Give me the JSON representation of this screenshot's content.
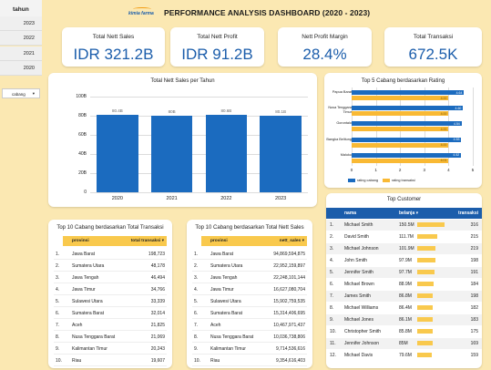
{
  "sidebar": {
    "header": "tahun",
    "years": [
      "2023",
      "2022",
      "2021",
      "2020"
    ],
    "filter_label": "cabang",
    "filter_chevron": "▾"
  },
  "header": {
    "logo_text": "kimia farma",
    "title": "PERFORMANCE ANALYSIS DASHBOARD (2020 - 2023)"
  },
  "kpis": [
    {
      "label": "Total Nett Sales",
      "value": "IDR 321.2B"
    },
    {
      "label": "Total Nett Profit",
      "value": "IDR 91.2B"
    },
    {
      "label": "Nett Profit Margin",
      "value": "28.4%"
    },
    {
      "label": "Total Transaksi",
      "value": "672.5K"
    }
  ],
  "sales_chart": {
    "title": "Total Nett Sales per Tahun",
    "y_ticks": [
      "100B",
      "80B",
      "60B",
      "40B",
      "20B",
      "0"
    ]
  },
  "rating_chart": {
    "title": "Top 5 Cabang berdasarkan Rating",
    "x_ticks": [
      "0",
      "1",
      "2",
      "3",
      "4",
      "5"
    ],
    "legend": {
      "rating_cabang": "rating cabang",
      "rating_transaksi": "rating transaksi"
    }
  },
  "table_trans": {
    "title": "Top 10 Cabang berdasarkan Total Transaksi",
    "col1": "provinsi",
    "col2": "total transaksi",
    "sort_icon": "▾",
    "rows": [
      {
        "no": "1.",
        "prov": "Jawa Barat",
        "val": "198,723"
      },
      {
        "no": "2.",
        "prov": "Sumatera Utara",
        "val": "48,178"
      },
      {
        "no": "3.",
        "prov": "Jawa Tengah",
        "val": "46,494"
      },
      {
        "no": "4.",
        "prov": "Jawa Timur",
        "val": "34,766"
      },
      {
        "no": "5.",
        "prov": "Sulawesi Utara",
        "val": "33,339"
      },
      {
        "no": "6.",
        "prov": "Sumatera Barat",
        "val": "32,014"
      },
      {
        "no": "7.",
        "prov": "Aceh",
        "val": "21,825"
      },
      {
        "no": "8.",
        "prov": "Nusa Tenggara Barat",
        "val": "21,069"
      },
      {
        "no": "9.",
        "prov": "Kalimantan Timur",
        "val": "20,243"
      },
      {
        "no": "10.",
        "prov": "Riau",
        "val": "19,607"
      }
    ]
  },
  "table_sales": {
    "title": "Top 10 Cabang berdasarkan Total Nett Sales",
    "col1": "provinsi",
    "col2": "nett_sales",
    "sort_icon": "▾",
    "rows": [
      {
        "no": "1.",
        "prov": "Jawa Barat",
        "val": "94,869,594,875"
      },
      {
        "no": "2.",
        "prov": "Sumatera Utara",
        "val": "22,952,159,897"
      },
      {
        "no": "3.",
        "prov": "Jawa Tengah",
        "val": "22,248,101,144"
      },
      {
        "no": "4.",
        "prov": "Jawa Timur",
        "val": "16,627,080,704"
      },
      {
        "no": "5.",
        "prov": "Sulawesi Utara",
        "val": "15,902,759,535"
      },
      {
        "no": "6.",
        "prov": "Sumatera Barat",
        "val": "15,314,406,695"
      },
      {
        "no": "7.",
        "prov": "Aceh",
        "val": "10,467,971,437"
      },
      {
        "no": "8.",
        "prov": "Nusa Tenggara Barat",
        "val": "10,036,738,806"
      },
      {
        "no": "9.",
        "prov": "Kalimantan Timur",
        "val": "9,714,536,616"
      },
      {
        "no": "10.",
        "prov": "Riau",
        "val": "9,354,616,403"
      }
    ]
  },
  "customers": {
    "title": "Top Customer",
    "col_name": "nama",
    "col_spend": "belanja",
    "col_trans": "transaksi",
    "sort_icon": "▾",
    "rows": [
      {
        "no": "1.",
        "name": "Michael Smith",
        "spend": "150.5M",
        "spend_num": 150.5,
        "trans": "316"
      },
      {
        "no": "2.",
        "name": "David Smith",
        "spend": "111.7M",
        "spend_num": 111.7,
        "trans": "215"
      },
      {
        "no": "3.",
        "name": "Michael Johnson",
        "spend": "101.9M",
        "spend_num": 101.9,
        "trans": "219"
      },
      {
        "no": "4.",
        "name": "John Smith",
        "spend": "97.9M",
        "spend_num": 97.9,
        "trans": "198"
      },
      {
        "no": "5.",
        "name": "Jennifer Smith",
        "spend": "97.7M",
        "spend_num": 97.7,
        "trans": "191"
      },
      {
        "no": "6.",
        "name": "Michael Brown",
        "spend": "88.9M",
        "spend_num": 88.9,
        "trans": "184"
      },
      {
        "no": "7.",
        "name": "James Smith",
        "spend": "86.8M",
        "spend_num": 86.8,
        "trans": "198"
      },
      {
        "no": "8.",
        "name": "Michael Williams",
        "spend": "86.4M",
        "spend_num": 86.4,
        "trans": "182"
      },
      {
        "no": "9.",
        "name": "Michael Jones",
        "spend": "86.1M",
        "spend_num": 86.1,
        "trans": "183"
      },
      {
        "no": "10.",
        "name": "Christopher Smith",
        "spend": "85.8M",
        "spend_num": 85.8,
        "trans": "175"
      },
      {
        "no": "11.",
        "name": "Jennifer Johnson",
        "spend": "85M",
        "spend_num": 85,
        "trans": "169"
      },
      {
        "no": "12.",
        "name": "Michael Davis",
        "spend": "79.6M",
        "spend_num": 79.6,
        "trans": "159"
      }
    ]
  },
  "colors": {
    "accent_blue": "#1b6bbf",
    "accent_yellow": "#f9b934",
    "background": "#fbe8b2"
  },
  "chart_data": [
    {
      "type": "bar",
      "title": "Total Nett Sales per Tahun",
      "categories": [
        "2020",
        "2021",
        "2022",
        "2023"
      ],
      "values": [
        80.48,
        80,
        80.68,
        80.19
      ],
      "data_labels": [
        "80.4B",
        "80B",
        "80.6B",
        "80.1B"
      ],
      "ylim": [
        0,
        100
      ],
      "grid": true
    },
    {
      "type": "bar",
      "title": "Top 5 Cabang berdasarkan Rating",
      "categories": [
        "Papua Barat",
        "Nusa Tenggara Timur",
        "Gorontalo",
        "Bangka Belitung",
        "Maluku"
      ],
      "series": [
        {
          "name": "rating cabang",
          "values": [
            4.64,
            4.6,
            4.54,
            4.53,
            4.52
          ],
          "labels": [
            "4.64",
            "4.60",
            "4.54",
            "4.53",
            "4.52"
          ]
        },
        {
          "name": "rating transaksi",
          "values": [
            4.0,
            4.0,
            4.0,
            4.0,
            4.0
          ],
          "labels": [
            "4.00",
            "4.00",
            "4.00",
            "4.00",
            "4.01"
          ]
        }
      ],
      "xlim": [
        0,
        5
      ],
      "legend": "bottom"
    }
  ]
}
